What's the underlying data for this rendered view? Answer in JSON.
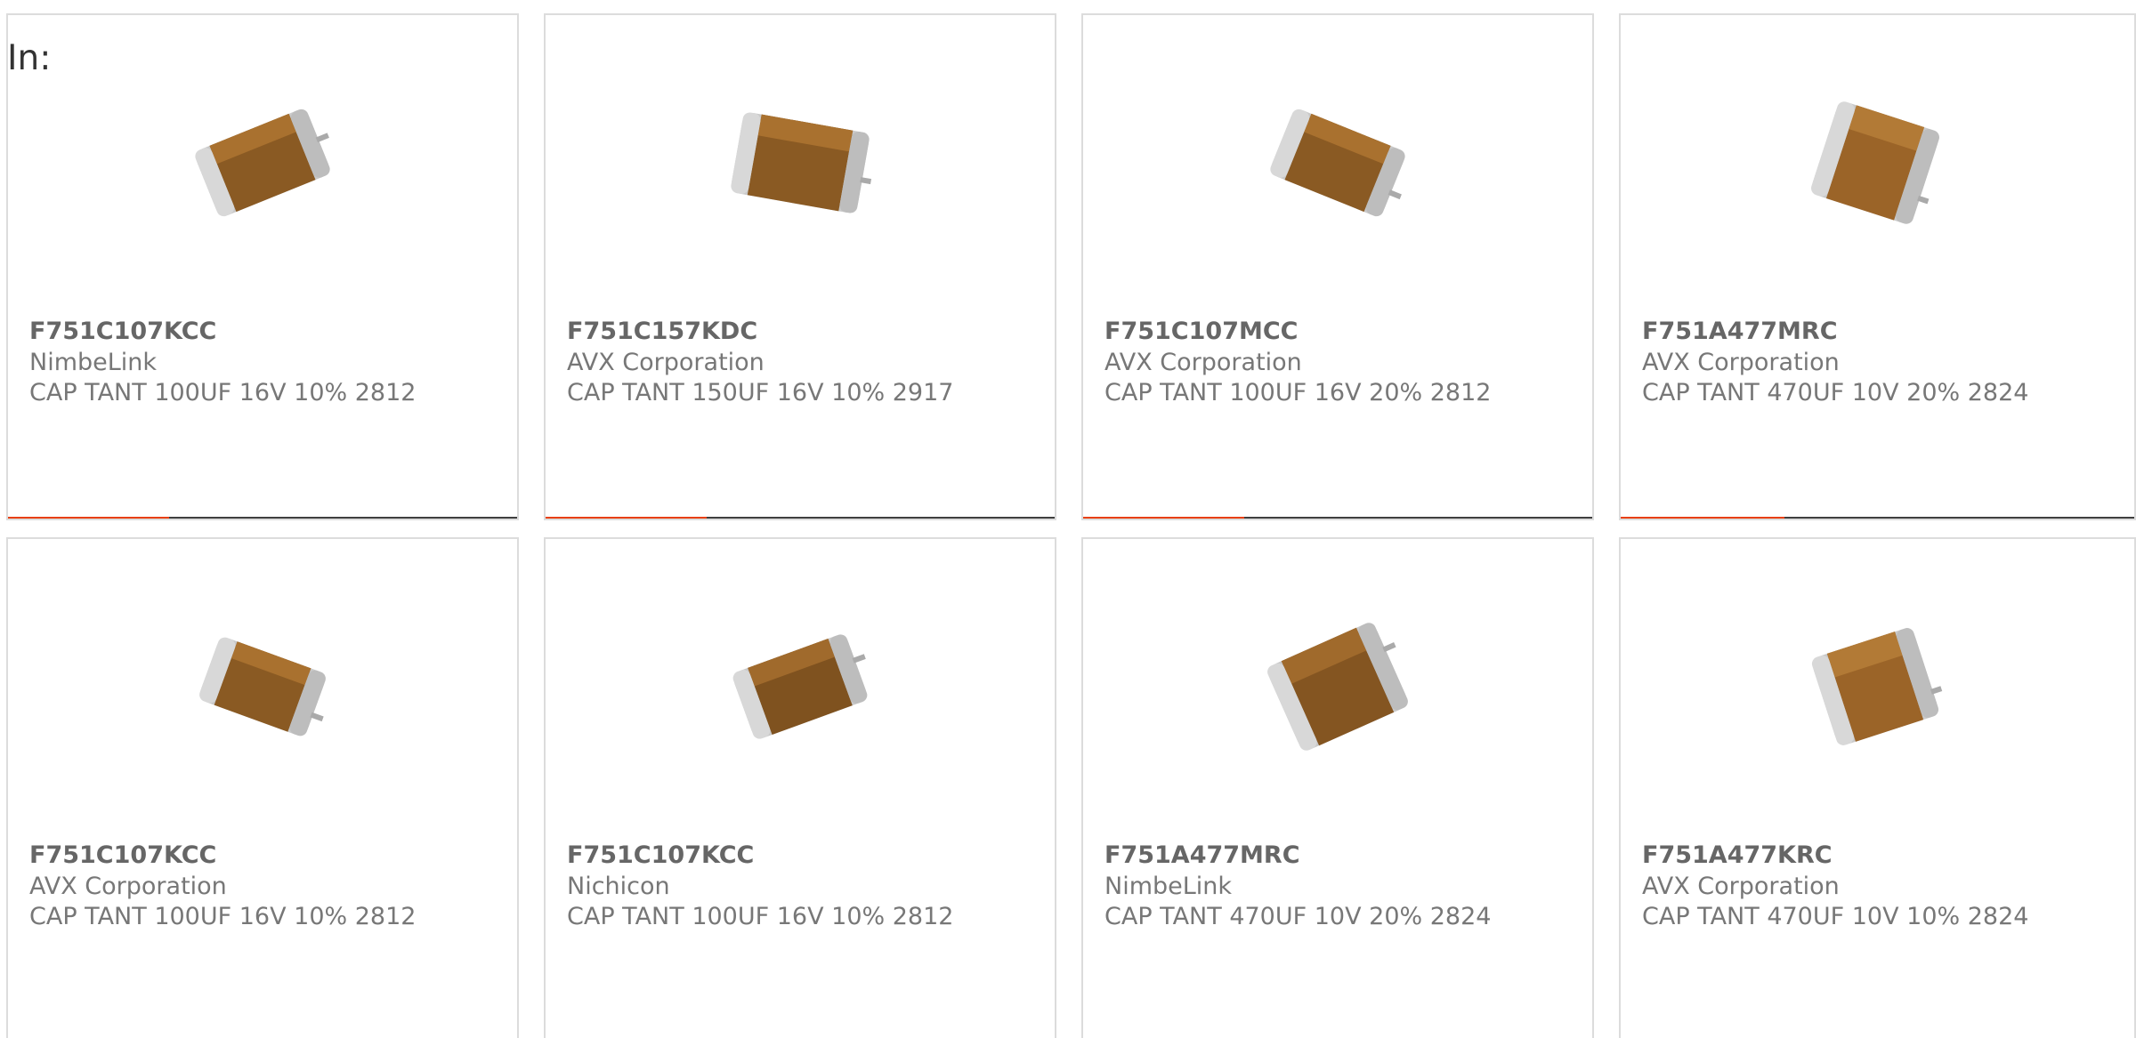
{
  "prefix_label": "In:",
  "colors": {
    "accent": "#e8400c",
    "bar_track": "#3f3f3f",
    "card_border": "#dcdcdc",
    "text_primary": "#666666",
    "text_secondary": "#777777"
  },
  "products": [
    {
      "part_number": "F751C107KCC",
      "manufacturer": "NimbeLink",
      "description": "CAP TANT 100UF 16V 10% 2812",
      "image": "tantalum-capacitor-image",
      "progress": 0.316
    },
    {
      "part_number": "F751C157KDC",
      "manufacturer": "AVX Corporation",
      "description": "CAP TANT 150UF 16V 10% 2917",
      "image": "tantalum-capacitor-image",
      "progress": 0.316
    },
    {
      "part_number": "F751C107MCC",
      "manufacturer": "AVX Corporation",
      "description": "CAP TANT 100UF 16V 20% 2812",
      "image": "tantalum-capacitor-image",
      "progress": 0.316
    },
    {
      "part_number": "F751A477MRC",
      "manufacturer": "AVX Corporation",
      "description": "CAP TANT 470UF 10V 20% 2824",
      "image": "tantalum-capacitor-image",
      "progress": 0.316
    },
    {
      "part_number": "F751C107KCC",
      "manufacturer": "AVX Corporation",
      "description": "CAP TANT 100UF 16V 10% 2812",
      "image": "tantalum-capacitor-image"
    },
    {
      "part_number": "F751C107KCC",
      "manufacturer": "Nichicon",
      "description": "CAP TANT 100UF 16V 10% 2812",
      "image": "tantalum-capacitor-image"
    },
    {
      "part_number": "F751A477MRC",
      "manufacturer": "NimbeLink",
      "description": "CAP TANT 470UF 10V 20% 2824",
      "image": "tantalum-capacitor-image"
    },
    {
      "part_number": "F751A477KRC",
      "manufacturer": "AVX Corporation",
      "description": "CAP TANT 470UF 10V 10% 2824",
      "image": "tantalum-capacitor-image"
    }
  ]
}
